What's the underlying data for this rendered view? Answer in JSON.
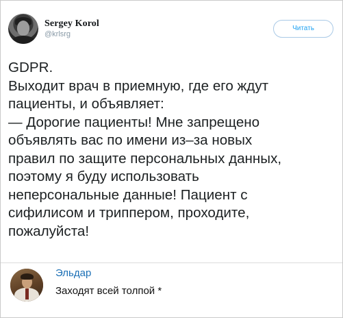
{
  "tweet": {
    "author": {
      "name": "Sergey Korol",
      "handle": "@krlsrg"
    },
    "follow_label": "Читать",
    "lines": [
      "GDPR.",
      "Выходит врач в приемную, где его ждут",
      "пациенты, и объявляет:",
      "— Дорогие пациенты! Мне запрещено",
      "объявлять вас по имени из–за новых",
      "правил по защите персональных данных,",
      "поэтому я буду использовать",
      "неперсональные данные! Пациент с",
      "сифилисом и триппером, проходите,",
      "пожалуйста!"
    ]
  },
  "reply": {
    "name": "Эльдар",
    "text": "Заходят всей толпой *"
  },
  "colors": {
    "link_blue": "#1da1f2",
    "reply_name": "#1b6fb5",
    "text": "#1c2022",
    "handle_gray": "#8899a6"
  }
}
